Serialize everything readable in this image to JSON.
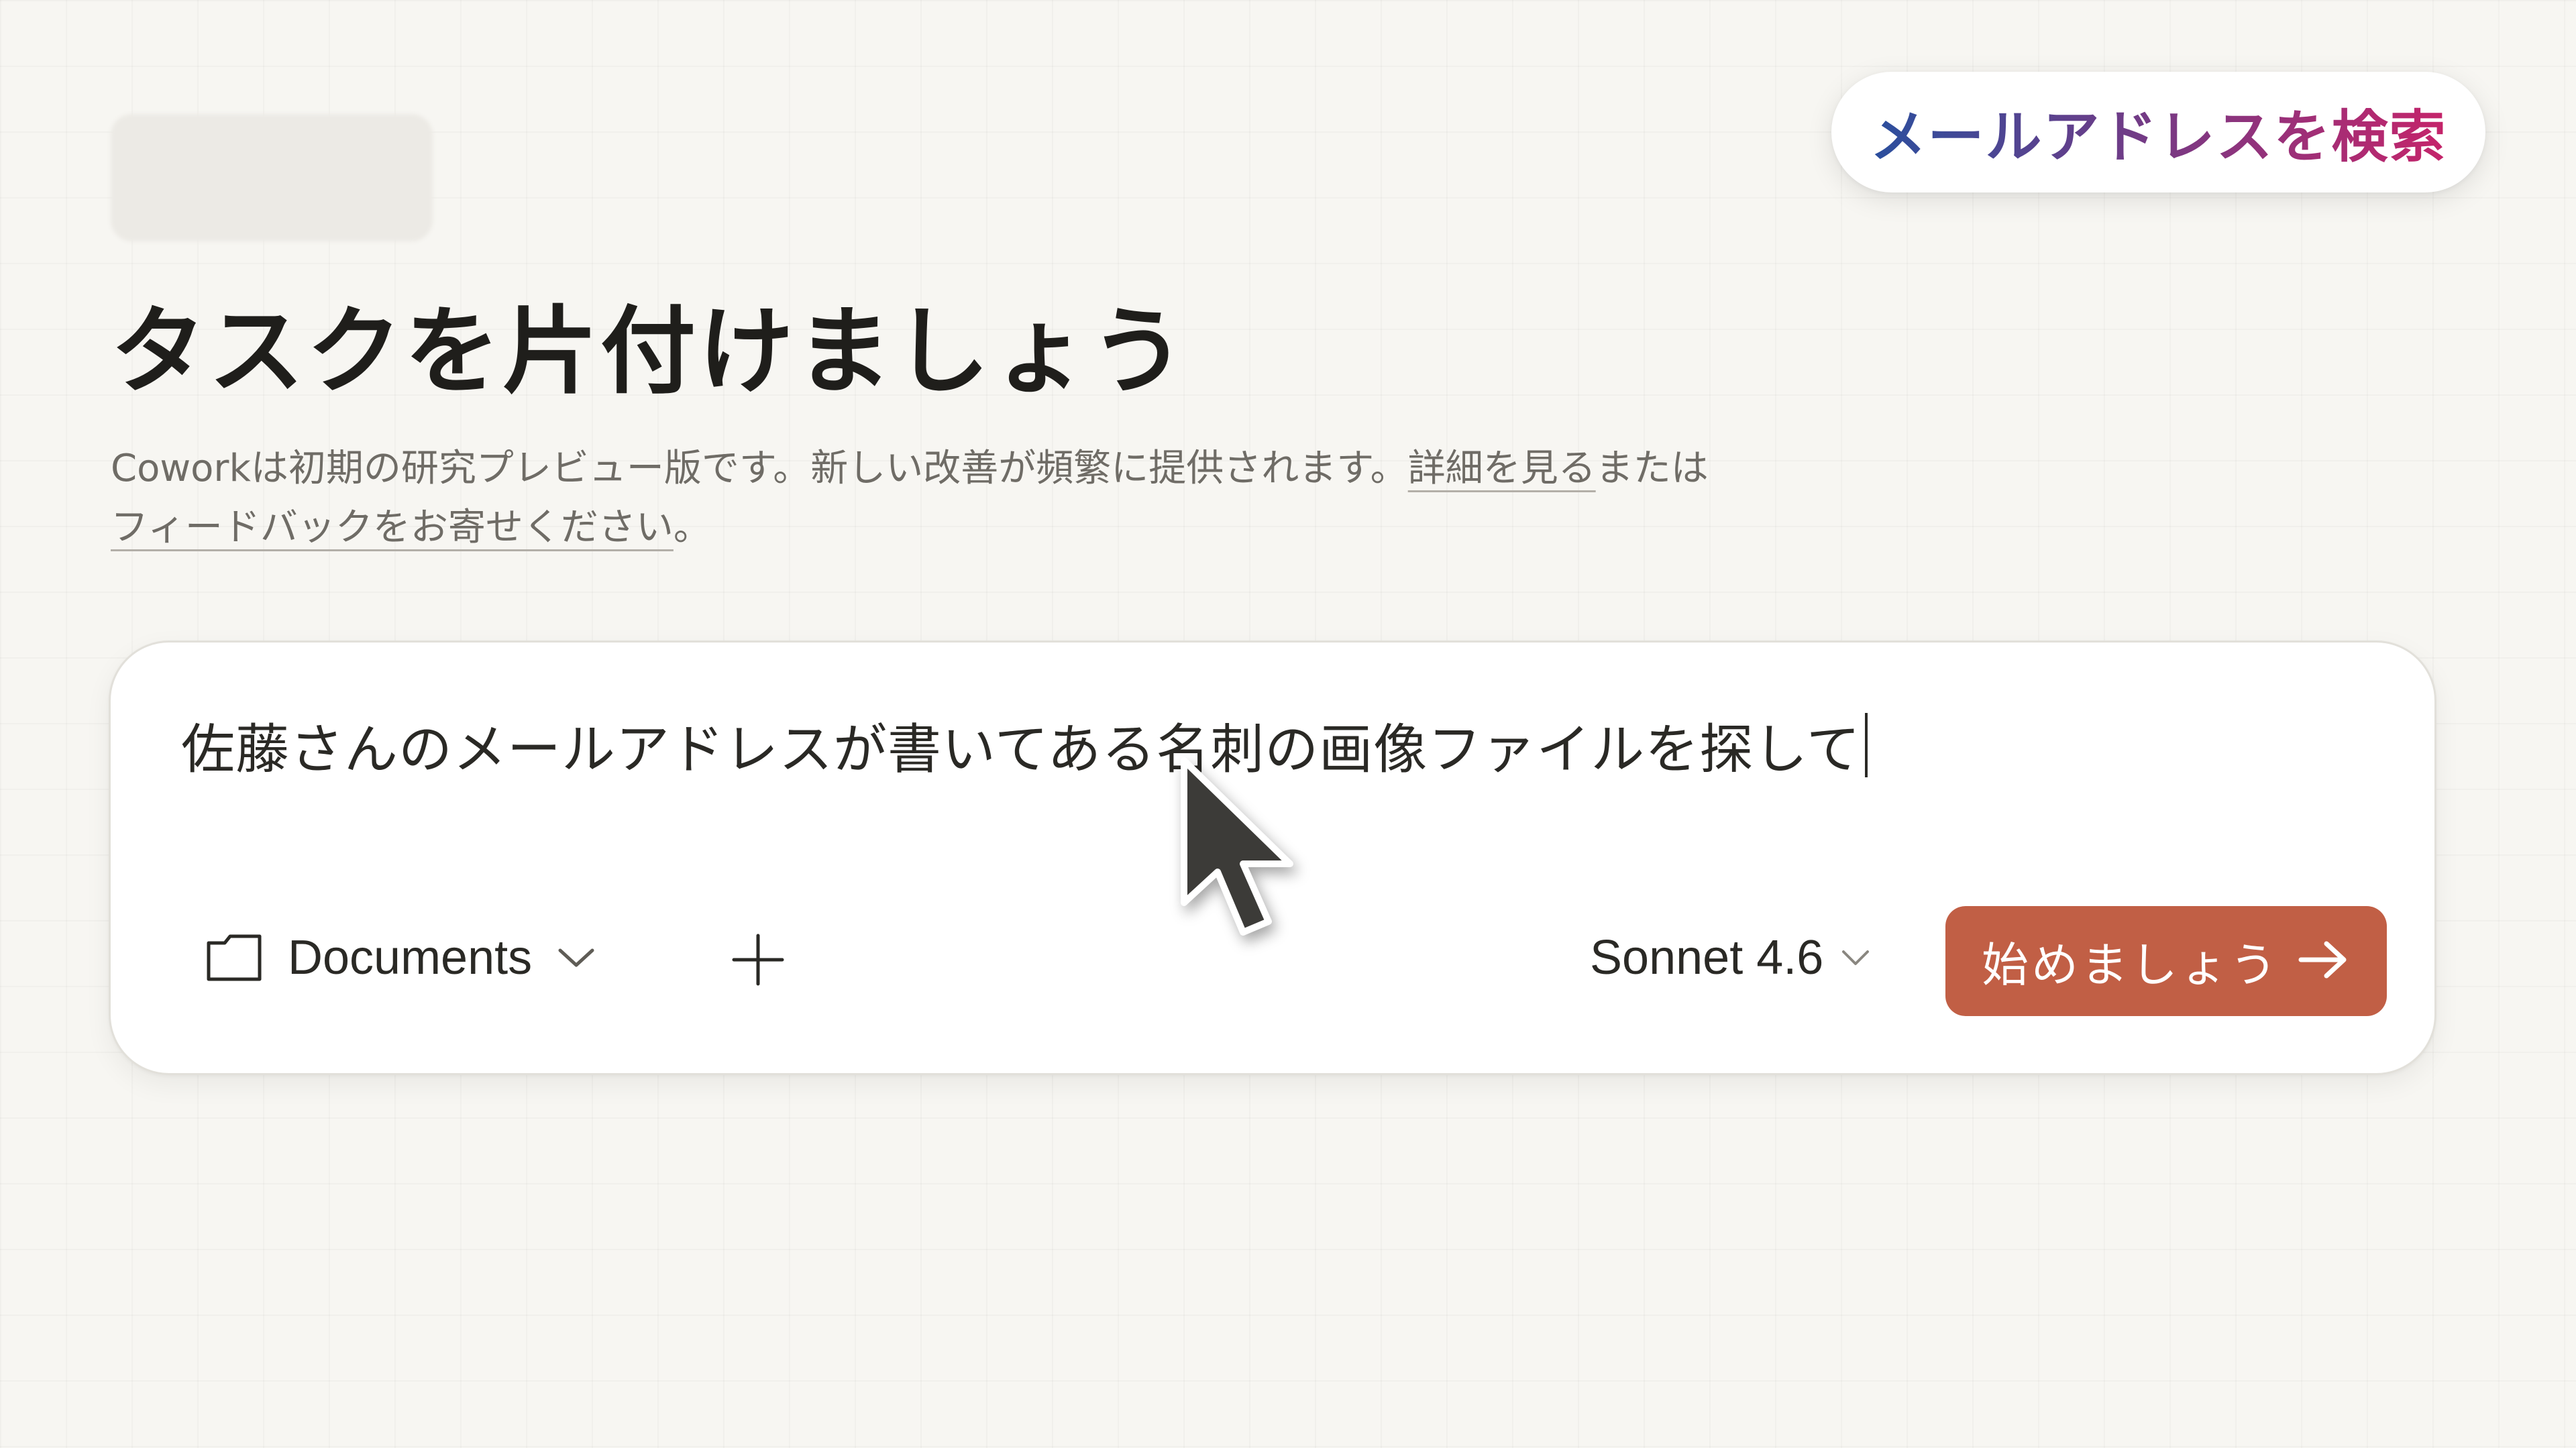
{
  "search_pill": {
    "label": "メールアドレスを検索",
    "gradient_colors": [
      "#2a4f9e",
      "#c5246a"
    ]
  },
  "header": {
    "title": "タスクを片付けましょう",
    "subtitle_text": "Coworkは初期の研究プレビュー版です。新しい改善が頻繁に提供されます。",
    "learn_more_link": "詳細を見る",
    "connector": "または",
    "feedback_link": "フィードバックをお寄せください",
    "period": "。"
  },
  "composer": {
    "input_value": "佐藤さんのメールアドレスが書いてある名刺の画像ファイルを探して",
    "folder_label": "Documents",
    "folder_icon": "folder-icon",
    "add_icon": "plus-icon",
    "model_label": "Sonnet 4.6",
    "start_label": "始めましょう",
    "start_icon": "arrow-right-icon",
    "accent_color": "#c15f45"
  }
}
